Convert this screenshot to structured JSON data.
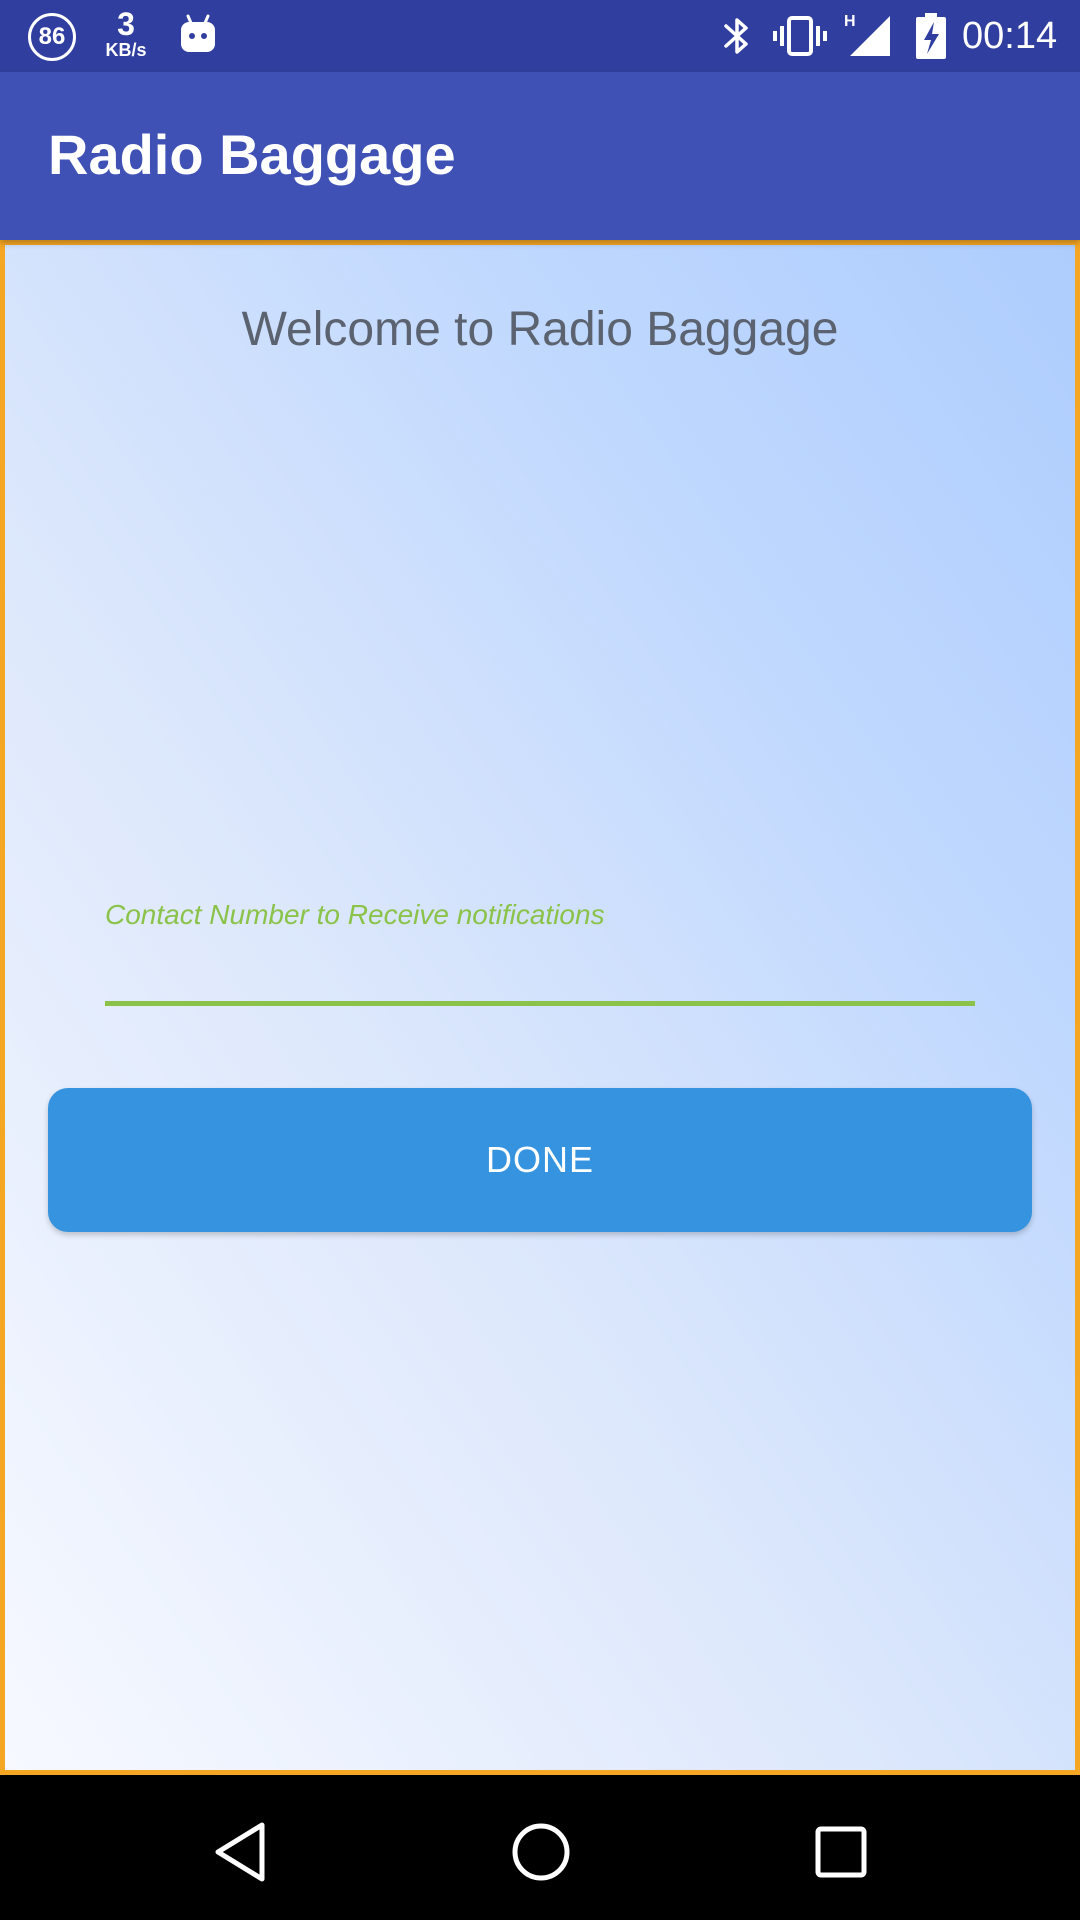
{
  "status_bar": {
    "notification_count": "86",
    "net_speed_value": "3",
    "net_speed_unit": "KB/s",
    "network_type": "H",
    "time": "00:14",
    "icons": [
      "android-debug-icon",
      "bluetooth-icon",
      "vibrate-icon",
      "signal-icon",
      "battery-charging-icon"
    ]
  },
  "app_bar": {
    "title": "Radio Baggage"
  },
  "main": {
    "welcome_text": "Welcome to Radio Baggage",
    "contact_field": {
      "label": "Contact Number to Receive notifications",
      "value": ""
    },
    "done_label": "DONE"
  },
  "nav_bar": {
    "icons": [
      "back-icon",
      "home-icon",
      "recent-apps-icon"
    ]
  },
  "colors": {
    "status_bar": "#303F9F",
    "app_bar": "#3F51B5",
    "accent_green": "#8BC34A",
    "button_blue": "#3593E0",
    "border_orange": "#F5A623"
  }
}
